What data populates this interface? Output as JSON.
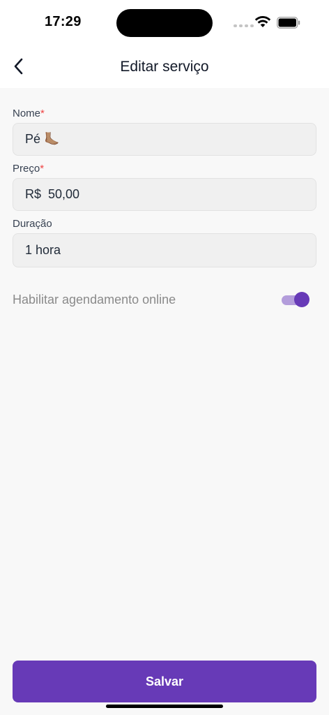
{
  "status_bar": {
    "time": "17:29"
  },
  "header": {
    "title": "Editar serviço"
  },
  "form": {
    "name": {
      "label": "Nome",
      "required_mark": "*",
      "value": "Pé 🦶🏽"
    },
    "price": {
      "label": "Preço",
      "required_mark": "*",
      "currency": "R$",
      "value": "50,00"
    },
    "duration": {
      "label": "Duração",
      "value": "1 hora"
    },
    "online_booking": {
      "label": "Habilitar agendamento online",
      "enabled": true
    }
  },
  "actions": {
    "save_label": "Salvar"
  },
  "colors": {
    "accent": "#673ab7",
    "toggle_track": "#b39ddb",
    "required": "#ef4444"
  },
  "icons": {
    "back": "chevron-left-icon",
    "wifi": "wifi-icon",
    "battery": "battery-icon",
    "signal": "cellular-signal-icon"
  }
}
